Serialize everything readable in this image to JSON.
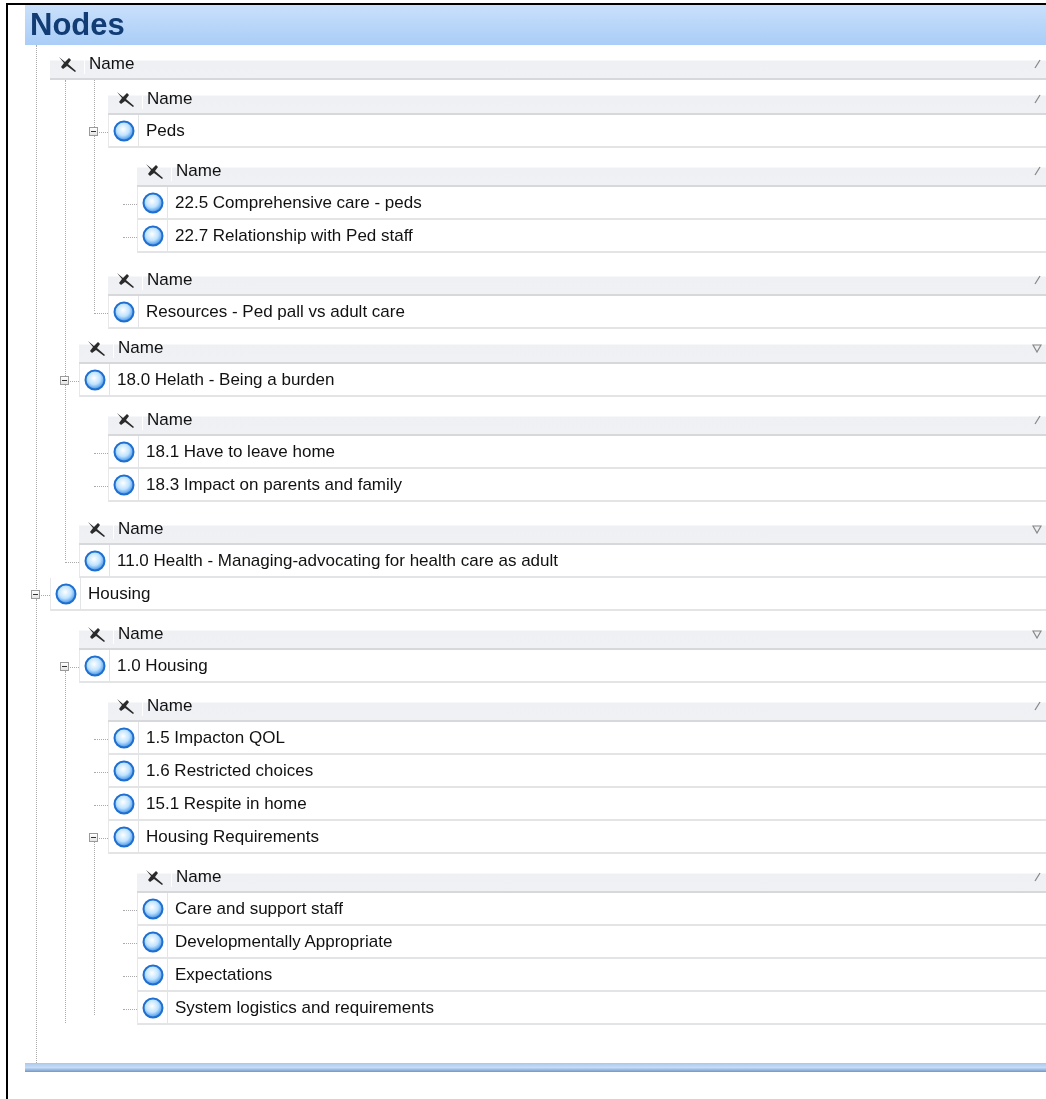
{
  "panel": {
    "title": "Nodes"
  },
  "tree": [
    {
      "kind": "header",
      "label": "Name",
      "filtered": false
    },
    {
      "kind": "continued",
      "children": [
        {
          "kind": "continued",
          "children": [
            {
              "kind": "header",
              "label": "Name",
              "filtered": false
            },
            {
              "kind": "node",
              "label": "Peds",
              "expanded": true,
              "children": [
                {
                  "kind": "header",
                  "label": "Name",
                  "filtered": false
                },
                {
                  "kind": "leaf",
                  "label": "22.5 Comprehensive care - peds"
                },
                {
                  "kind": "leaf",
                  "label": "22.7 Relationship with Ped staff"
                }
              ]
            },
            {
              "kind": "header",
              "label": "Name",
              "filtered": false
            },
            {
              "kind": "leaf",
              "label": "Resources - Ped pall vs adult care"
            }
          ]
        },
        {
          "kind": "header",
          "label": "Name",
          "filtered": true
        },
        {
          "kind": "node",
          "label": "18.0 Helath - Being a burden",
          "expanded": true,
          "children": [
            {
              "kind": "header",
              "label": "Name",
              "filtered": false
            },
            {
              "kind": "leaf",
              "label": "18.1 Have to leave home"
            },
            {
              "kind": "leaf",
              "label": "18.3 Impact on parents and family"
            }
          ]
        },
        {
          "kind": "header",
          "label": "Name",
          "filtered": true
        },
        {
          "kind": "leaf",
          "label": "11.0 Health - Managing-advocating for health care as adult"
        }
      ]
    },
    {
      "kind": "node",
      "label": "Housing",
      "expanded": true,
      "children": [
        {
          "kind": "header",
          "label": "Name",
          "filtered": true
        },
        {
          "kind": "node",
          "label": "1.0 Housing",
          "expanded": true,
          "children": [
            {
              "kind": "header",
              "label": "Name",
              "filtered": false
            },
            {
              "kind": "leaf",
              "label": "1.5 Impacton QOL"
            },
            {
              "kind": "leaf",
              "label": "1.6 Restricted choices"
            },
            {
              "kind": "leaf",
              "label": "15.1 Respite in home"
            },
            {
              "kind": "node",
              "label": "Housing Requirements",
              "expanded": true,
              "children": [
                {
                  "kind": "header",
                  "label": "Name",
                  "filtered": false
                },
                {
                  "kind": "leaf",
                  "label": "Care and support staff"
                },
                {
                  "kind": "leaf",
                  "label": "Developmentally Appropriate"
                },
                {
                  "kind": "leaf",
                  "label": "Expectations"
                },
                {
                  "kind": "leaf",
                  "label": "System logistics and requirements"
                }
              ]
            }
          ]
        }
      ]
    }
  ]
}
